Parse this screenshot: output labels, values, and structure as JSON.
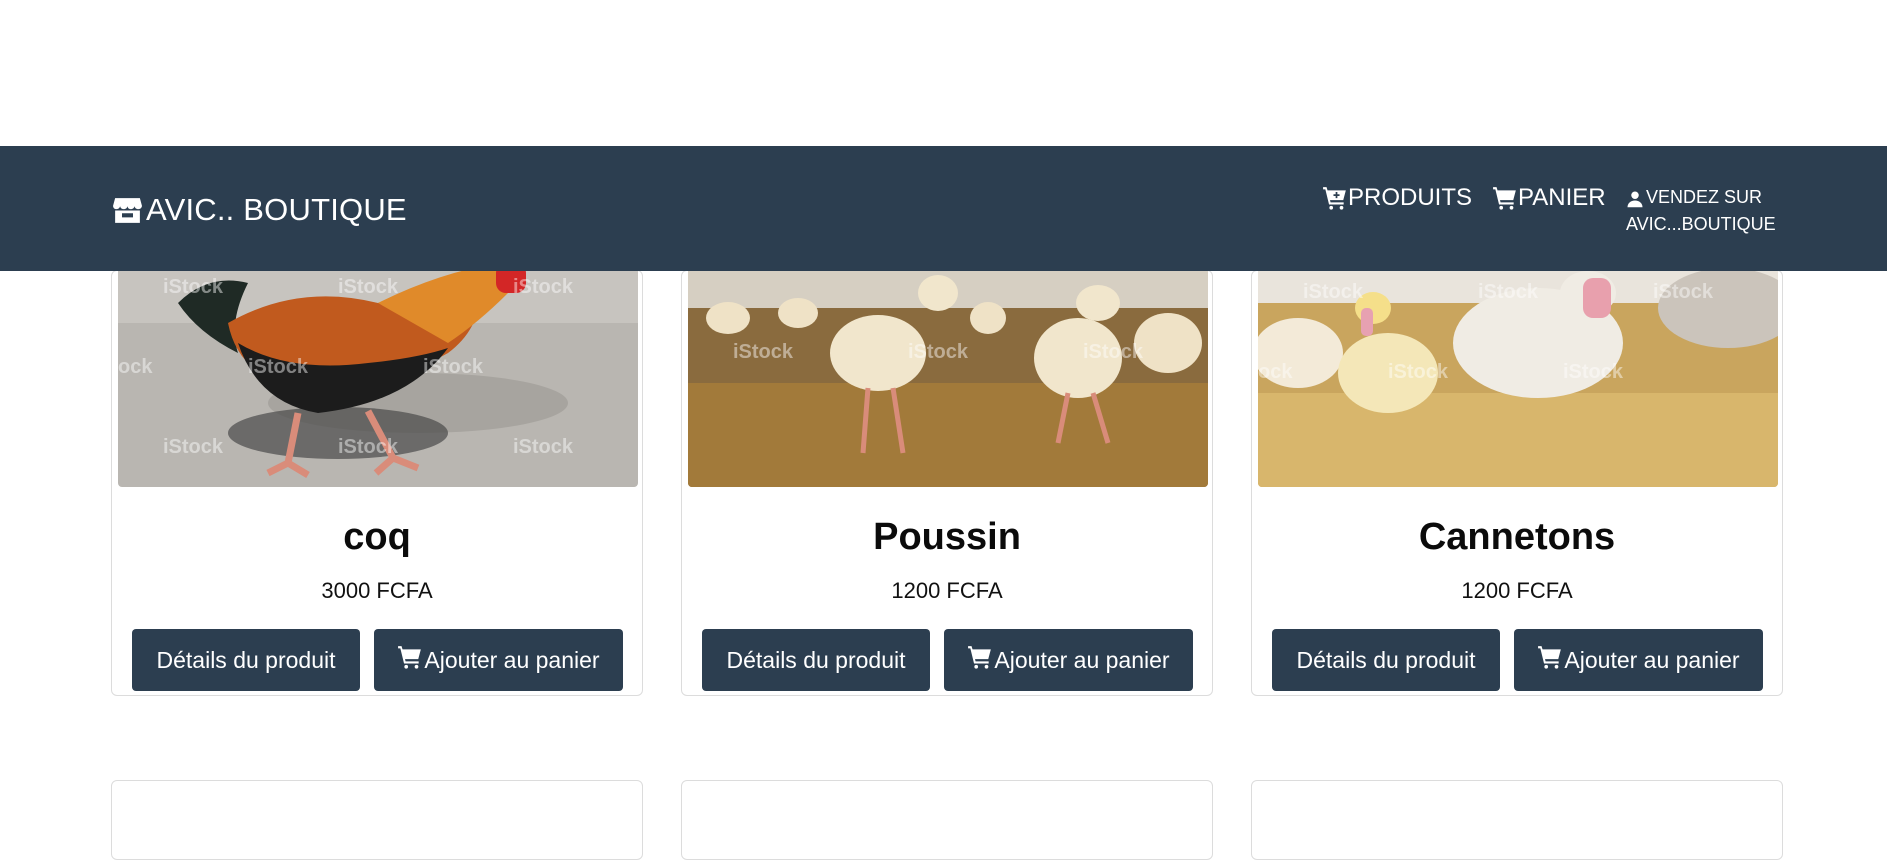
{
  "brand": {
    "icon": "store-icon",
    "label": "AVIC.. BOUTIQUE"
  },
  "nav": {
    "products": {
      "icon": "cart-plus-icon",
      "label": "PRODUITS"
    },
    "cart": {
      "icon": "cart-icon",
      "label": "PANIER"
    },
    "sell": {
      "icon": "user-icon",
      "line1": "VENDEZ SUR",
      "line2": "AVIC...BOUTIQUE"
    }
  },
  "products": [
    {
      "name": "coq",
      "price": "3000 FCFA",
      "image": "rooster-photo",
      "details_label": "Détails du produit",
      "add_label": "Ajouter au panier"
    },
    {
      "name": "Poussin",
      "price": "1200 FCFA",
      "image": "chicks-photo",
      "details_label": "Détails du produit",
      "add_label": "Ajouter au panier"
    },
    {
      "name": "Cannetons",
      "price": "1200 FCFA",
      "image": "ducklings-photo",
      "details_label": "Détails du produit",
      "add_label": "Ajouter au panier"
    }
  ],
  "watermark": "iStock",
  "colors": {
    "navbar": "#2c3e50",
    "button": "#2c3e50",
    "text": "#111111"
  }
}
